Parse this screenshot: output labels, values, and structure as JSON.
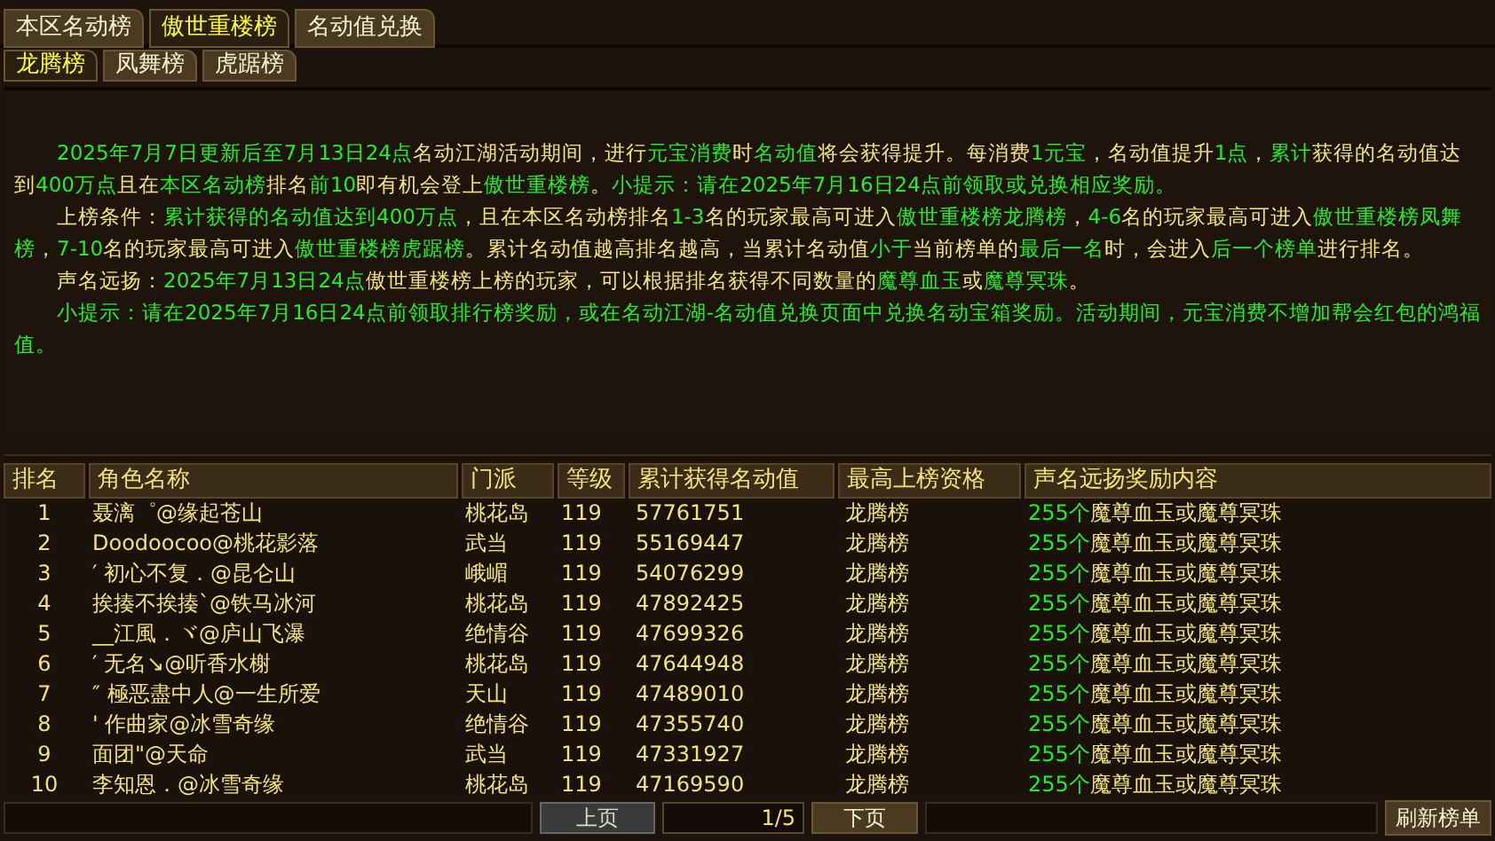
{
  "main_tabs": [
    {
      "label": "本区名动榜",
      "selected": false
    },
    {
      "label": "傲世重楼榜",
      "selected": true
    },
    {
      "label": "名动值兑换",
      "selected": false
    }
  ],
  "sub_tabs": [
    {
      "label": "龙腾榜",
      "selected": true
    },
    {
      "label": "凤舞榜",
      "selected": false
    },
    {
      "label": "虎踞榜",
      "selected": false
    }
  ],
  "paragraphs": [
    {
      "segments": [
        {
          "text": "2025年7月7日更新后至7月13日24点",
          "kind": "highlight"
        },
        {
          "text": "名动江湖活动期间，进行",
          "kind": "plain"
        },
        {
          "text": "元宝消费",
          "kind": "highlight"
        },
        {
          "text": "时",
          "kind": "plain"
        },
        {
          "text": "名动值",
          "kind": "highlight"
        },
        {
          "text": "将会获得提升。每消费",
          "kind": "plain"
        },
        {
          "text": "1元宝",
          "kind": "highlight"
        },
        {
          "text": "，名动值提升",
          "kind": "plain"
        },
        {
          "text": "1点",
          "kind": "highlight"
        },
        {
          "text": "，",
          "kind": "plain"
        },
        {
          "text": "累计",
          "kind": "highlight"
        },
        {
          "text": "获得的名动值达到",
          "kind": "plain"
        },
        {
          "text": "400万点",
          "kind": "highlight"
        },
        {
          "text": "且在",
          "kind": "plain"
        },
        {
          "text": "本区名动榜",
          "kind": "highlight"
        },
        {
          "text": "排名",
          "kind": "plain"
        },
        {
          "text": "前10",
          "kind": "highlight"
        },
        {
          "text": "即有机会登上",
          "kind": "plain"
        },
        {
          "text": "傲世重楼榜",
          "kind": "highlight"
        },
        {
          "text": "。",
          "kind": "plain"
        },
        {
          "text": "小提示：请在2025年7月16日24点前领取或兑换相应奖励。",
          "kind": "highlight"
        }
      ]
    },
    {
      "segments": [
        {
          "text": "上榜条件：",
          "kind": "plain"
        },
        {
          "text": "累计获得的名动值达到400万点",
          "kind": "highlight"
        },
        {
          "text": "，且在本区名动榜排名",
          "kind": "plain"
        },
        {
          "text": "1-3",
          "kind": "highlight"
        },
        {
          "text": "名的玩家最高可进入",
          "kind": "plain"
        },
        {
          "text": "傲世重楼榜龙腾榜",
          "kind": "highlight"
        },
        {
          "text": "，",
          "kind": "plain"
        },
        {
          "text": "4-6",
          "kind": "highlight"
        },
        {
          "text": "名的玩家最高可进入",
          "kind": "plain"
        },
        {
          "text": "傲世重楼榜凤舞榜",
          "kind": "highlight"
        },
        {
          "text": "，",
          "kind": "plain"
        },
        {
          "text": "7-10",
          "kind": "highlight"
        },
        {
          "text": "名的玩家最高可进入",
          "kind": "plain"
        },
        {
          "text": "傲世重楼榜虎踞榜",
          "kind": "highlight"
        },
        {
          "text": "。累计名动值越高排名越高，当累计名动值",
          "kind": "plain"
        },
        {
          "text": "小于",
          "kind": "highlight"
        },
        {
          "text": "当前榜单的",
          "kind": "plain"
        },
        {
          "text": "最后一名",
          "kind": "highlight"
        },
        {
          "text": "时，会进入",
          "kind": "plain"
        },
        {
          "text": "后一个榜单",
          "kind": "highlight"
        },
        {
          "text": "进行排名。",
          "kind": "plain"
        }
      ]
    },
    {
      "segments": [
        {
          "text": "声名远扬：",
          "kind": "plain"
        },
        {
          "text": "2025年7月13日24点",
          "kind": "highlight"
        },
        {
          "text": "傲世重楼榜上榜的玩家，可以根据排名获得不同数量的",
          "kind": "plain"
        },
        {
          "text": "魔尊血玉",
          "kind": "highlight"
        },
        {
          "text": "或",
          "kind": "plain"
        },
        {
          "text": "魔尊冥珠",
          "kind": "highlight"
        },
        {
          "text": "。",
          "kind": "plain"
        }
      ]
    },
    {
      "segments": [
        {
          "text": "小提示：请在2025年7月16日24点前领取排行榜奖励，或在名动江湖-名动值兑换页面中兑换名动宝箱奖励。活动期间，元宝消费不增加帮会红包的鸿福值。",
          "kind": "highlight"
        }
      ]
    }
  ],
  "table": {
    "columns": [
      "排名",
      "角色名称",
      "门派",
      "等级",
      "累计获得名动值",
      "最高上榜资格",
      "声名远扬奖励内容"
    ],
    "rows": [
      {
        "rank": "1",
        "name": "聂漓゜@缘起苍山",
        "sect": "桃花岛",
        "level": "119",
        "value": "57761751",
        "tier": "龙腾榜",
        "reward_count": "255个",
        "reward_item": "魔尊血玉或魔尊冥珠"
      },
      {
        "rank": "2",
        "name": "Doodoocoo@桃花影落",
        "sect": "武当",
        "level": "119",
        "value": "55169447",
        "tier": "龙腾榜",
        "reward_count": "255个",
        "reward_item": "魔尊血玉或魔尊冥珠"
      },
      {
        "rank": "3",
        "name": "′ 初心不复．@昆仑山",
        "sect": "峨嵋",
        "level": "119",
        "value": "54076299",
        "tier": "龙腾榜",
        "reward_count": "255个",
        "reward_item": "魔尊血玉或魔尊冥珠"
      },
      {
        "rank": "4",
        "name": "挨揍不挨揍ˋ@铁马冰河",
        "sect": "桃花岛",
        "level": "119",
        "value": "47892425",
        "tier": "龙腾榜",
        "reward_count": "255个",
        "reward_item": "魔尊血玉或魔尊冥珠"
      },
      {
        "rank": "5",
        "name": "__江風．ヾ@庐山飞瀑",
        "sect": "绝情谷",
        "level": "119",
        "value": "47699326",
        "tier": "龙腾榜",
        "reward_count": "255个",
        "reward_item": "魔尊血玉或魔尊冥珠"
      },
      {
        "rank": "6",
        "name": "′ 无名↘@听香水榭",
        "sect": "桃花岛",
        "level": "119",
        "value": "47644948",
        "tier": "龙腾榜",
        "reward_count": "255个",
        "reward_item": "魔尊血玉或魔尊冥珠"
      },
      {
        "rank": "7",
        "name": "″ 極恶盡中人@一生所爱",
        "sect": "天山",
        "level": "119",
        "value": "47489010",
        "tier": "龙腾榜",
        "reward_count": "255个",
        "reward_item": "魔尊血玉或魔尊冥珠"
      },
      {
        "rank": "8",
        "name": "' 作曲家@冰雪奇缘",
        "sect": "绝情谷",
        "level": "119",
        "value": "47355740",
        "tier": "龙腾榜",
        "reward_count": "255个",
        "reward_item": "魔尊血玉或魔尊冥珠"
      },
      {
        "rank": "9",
        "name": "面团\"@天命",
        "sect": "武当",
        "level": "119",
        "value": "47331927",
        "tier": "龙腾榜",
        "reward_count": "255个",
        "reward_item": "魔尊血玉或魔尊冥珠"
      },
      {
        "rank": "10",
        "name": "李知恩．@冰雪奇缘",
        "sect": "桃花岛",
        "level": "119",
        "value": "47169590",
        "tier": "龙腾榜",
        "reward_count": "255个",
        "reward_item": "魔尊血玉或魔尊冥珠"
      }
    ]
  },
  "pager": {
    "prev": "上页",
    "page": "1/5",
    "next": "下页"
  },
  "refresh_button": "刷新榜单"
}
